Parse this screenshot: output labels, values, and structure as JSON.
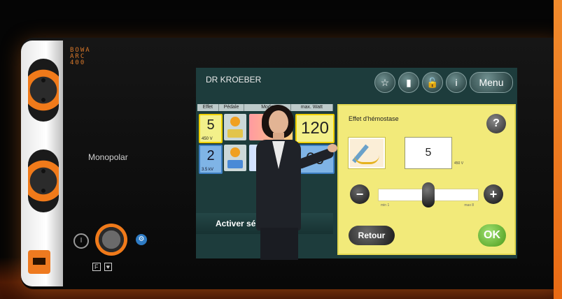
{
  "device": {
    "brand_lines": [
      "BOWA",
      "ARC",
      "400"
    ],
    "mode_label": "Monopolar",
    "power_symbol": "I",
    "knob_symbol": "⚙",
    "pedal_labels": [
      "F",
      "♥"
    ]
  },
  "screen": {
    "title": "DR KROEBER",
    "top_icons": [
      {
        "icon": "star-icon",
        "glyph": "☆"
      },
      {
        "icon": "book-icon",
        "glyph": "▮"
      },
      {
        "icon": "unlock-icon",
        "glyph": "🔓"
      },
      {
        "icon": "info-icon",
        "glyph": "i"
      }
    ],
    "menu_label": "Menu",
    "table": {
      "headers": [
        "Effet",
        "Pédale",
        "Mode",
        "max. Watt"
      ],
      "rows": [
        {
          "effect": "5",
          "effect_sub": "450 V",
          "watt": "120",
          "color": "yellow"
        },
        {
          "effect": "2",
          "effect_sub": "3.5 kV",
          "watt": "60",
          "color": "blue"
        }
      ]
    },
    "activate_label": "Activer sé",
    "dialog": {
      "title": "Effet d'hémostase",
      "help_glyph": "?",
      "value": "5",
      "unit": "450 V",
      "slider_min": "min 1",
      "slider_max": "max 8",
      "slider_fraction": 0.5,
      "minus_glyph": "−",
      "plus_glyph": "+",
      "back_label": "Retour",
      "ok_label": "OK"
    }
  },
  "colors": {
    "accent_orange": "#f07a1a",
    "screen_bg": "#1d3c3c",
    "dialog_bg": "#f2ea7a",
    "ok_green": "#4a9a1a",
    "row_yellow": "#f3f08a",
    "row_blue": "#7fb4e6"
  }
}
